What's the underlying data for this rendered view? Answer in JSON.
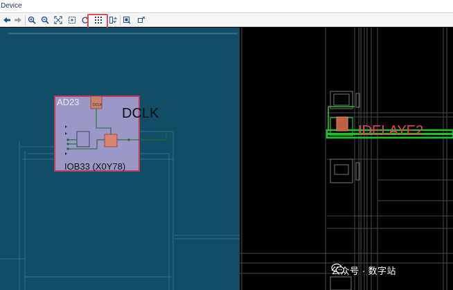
{
  "window": {
    "title": "Device"
  },
  "toolbar": {
    "buttons": [
      {
        "name": "back-icon"
      },
      {
        "name": "forward-icon"
      },
      {
        "name": "zoom-in-icon"
      },
      {
        "name": "zoom-out-icon"
      },
      {
        "name": "zoom-fit-icon"
      },
      {
        "name": "zoom-area-icon"
      },
      {
        "name": "refresh-icon"
      },
      {
        "name": "routing-resources-icon"
      },
      {
        "name": "flip-icon"
      },
      {
        "name": "select-icon"
      },
      {
        "name": "unselect-icon"
      }
    ],
    "highlight_badge": "1"
  },
  "device": {
    "pad_label": "AD23",
    "net_label": "DCLK",
    "site_label": "IOB33 (X0Y78)",
    "target_label": "IDELAYE2"
  },
  "watermark": {
    "text": "公众号 · 数字站"
  },
  "colors": {
    "left_region": "#124d68",
    "right_region": "#000000",
    "iob_fill": "#9b97c7",
    "iob_border": "#c43a5a",
    "route_green": "#22c22e",
    "highlight": "#e5484d"
  }
}
